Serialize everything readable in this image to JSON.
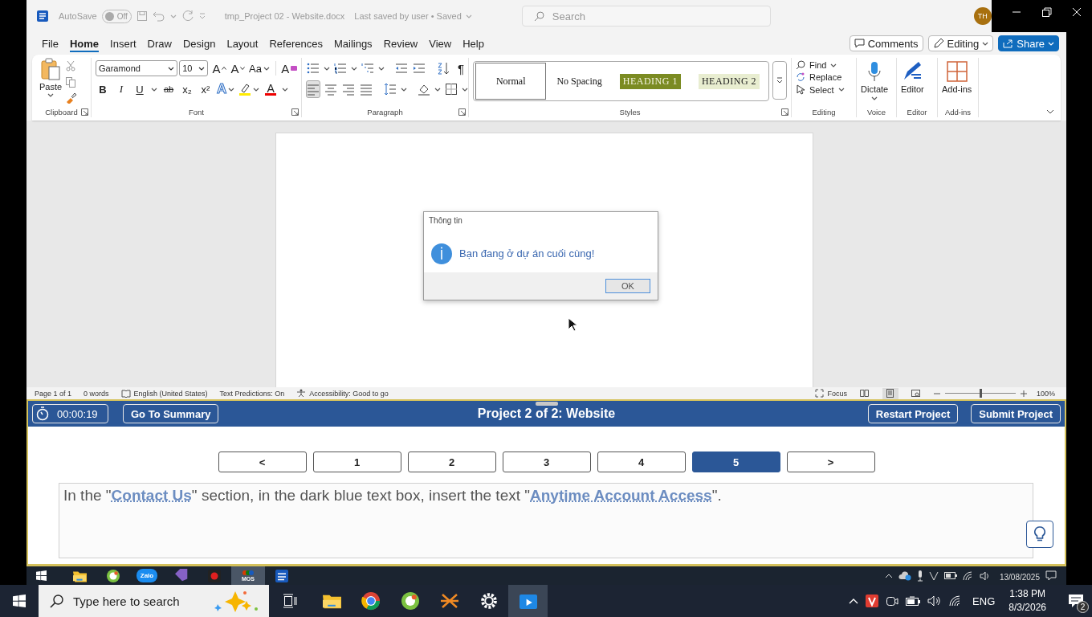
{
  "title_bar": {
    "autosave_label": "AutoSave",
    "autosave_toggle": {
      "label": "Off",
      "on": false
    },
    "document_title": "tmp_Project 02 - Website.docx",
    "save_status": "Last saved by user • Saved",
    "search": {
      "placeholder": "Search"
    },
    "avatar": "TH"
  },
  "ribbon_tabs": [
    {
      "label": "File",
      "selected": false
    },
    {
      "label": "Home",
      "selected": true
    },
    {
      "label": "Insert",
      "selected": false
    },
    {
      "label": "Draw",
      "selected": false
    },
    {
      "label": "Design",
      "selected": false
    },
    {
      "label": "Layout",
      "selected": false
    },
    {
      "label": "References",
      "selected": false
    },
    {
      "label": "Mailings",
      "selected": false
    },
    {
      "label": "Review",
      "selected": false
    },
    {
      "label": "View",
      "selected": false
    },
    {
      "label": "Help",
      "selected": false
    }
  ],
  "ribbon_actions": [
    {
      "kind": "comments",
      "label": "Comments"
    },
    {
      "kind": "editing",
      "label": "Editing"
    },
    {
      "kind": "share",
      "label": "Share"
    }
  ],
  "ribbon": {
    "clipboard": {
      "label": "Clipboard",
      "paste": "Paste"
    },
    "font": {
      "label": "Font",
      "font_name": "Garamond",
      "font_size": "10",
      "row1": [
        {
          "kind": "grow",
          "label": "A"
        },
        {
          "kind": "shrink",
          "label": "A"
        },
        {
          "kind": "case",
          "label": "Aa"
        },
        {
          "kind": "clear",
          "label": "A"
        }
      ],
      "row2": [
        {
          "kind": "bold",
          "label": "B"
        },
        {
          "kind": "italic",
          "label": "I"
        },
        {
          "kind": "underline",
          "label": "U"
        },
        {
          "kind": "strike",
          "label": "ab"
        },
        {
          "kind": "subscript",
          "label": "x₂"
        },
        {
          "kind": "superscript",
          "label": "x²"
        },
        {
          "kind": "effects",
          "label": "A"
        },
        {
          "kind": "highlight"
        },
        {
          "kind": "color",
          "label": "A"
        }
      ]
    },
    "paragraph": {
      "label": "Paragraph",
      "row1": [
        {
          "kind": "bullets"
        },
        {
          "kind": "numbering"
        },
        {
          "kind": "multilevel"
        },
        {
          "kind": "outdent"
        },
        {
          "kind": "indent"
        },
        {
          "kind": "sort"
        },
        {
          "kind": "marks",
          "label": "¶"
        }
      ],
      "row2": [
        {
          "kind": "align-left",
          "selected": true
        },
        {
          "kind": "align-center",
          "selected": false
        },
        {
          "kind": "align-right",
          "selected": false
        },
        {
          "kind": "justify",
          "selected": false
        },
        {
          "kind": "line-spacing"
        },
        {
          "kind": "shading"
        },
        {
          "kind": "borders"
        }
      ]
    },
    "styles": {
      "label": "Styles",
      "items": [
        {
          "kind": "normal",
          "label": "Normal",
          "selected": true
        },
        {
          "kind": "no-spacing",
          "label": "No Spacing",
          "selected": false
        },
        {
          "kind": "heading1",
          "label": "HEADING 1",
          "selected": false
        },
        {
          "kind": "heading2",
          "label": "HEADING 2",
          "selected": false
        }
      ]
    },
    "editing": {
      "label": "Editing",
      "items": [
        {
          "kind": "find",
          "label": "Find"
        },
        {
          "kind": "replace",
          "label": "Replace"
        },
        {
          "kind": "select",
          "label": "Select"
        }
      ]
    },
    "voice": {
      "label": "Voice",
      "button": "Dictate"
    },
    "editor": {
      "label": "Editor",
      "button": "Editor"
    },
    "addins": {
      "label": "Add-ins",
      "button": "Add-ins"
    }
  },
  "dialog": {
    "title": "Thông tin",
    "message": "Bạn đang ở dự án cuối cùng!",
    "button": "OK"
  },
  "status_bar": {
    "items": [
      "Page 1 of 1",
      "0 words",
      "English (United States)",
      "Text Predictions: On",
      "Accessibility: Good to go"
    ],
    "focus": "Focus",
    "views": [
      {
        "kind": "read",
        "selected": false
      },
      {
        "kind": "print",
        "selected": true
      },
      {
        "kind": "web",
        "selected": false
      }
    ],
    "zoom_slider": {
      "level": 0.5
    },
    "zoom": "100%"
  },
  "test_panel": {
    "timer": "00:00:19",
    "summary_button": "Go To Summary",
    "title": "Project 2 of 2: Website",
    "buttons": [
      "Restart Project",
      "Submit Project"
    ],
    "pages": [
      {
        "label": "<",
        "selected": false
      },
      {
        "label": "1",
        "selected": false
      },
      {
        "label": "2",
        "selected": false
      },
      {
        "label": "3",
        "selected": false
      },
      {
        "label": "4",
        "selected": false
      },
      {
        "label": "5",
        "selected": true
      },
      {
        "label": ">",
        "selected": false
      }
    ],
    "instruction": [
      {
        "kind": "text",
        "text": "In the \""
      },
      {
        "kind": "link",
        "text": "Contact Us"
      },
      {
        "kind": "text",
        "text": "\" section, in the dark blue text box, insert the text \""
      },
      {
        "kind": "link",
        "text": "Anytime Account Access"
      },
      {
        "kind": "text",
        "text": "\"."
      }
    ]
  },
  "inner_taskbar": {
    "apps": [
      {
        "kind": "folder",
        "selected": false
      },
      {
        "kind": "browser-green",
        "selected": false
      },
      {
        "kind": "chat",
        "label": "Zalo",
        "selected": false
      },
      {
        "kind": "ide",
        "selected": false
      },
      {
        "kind": "recorder",
        "selected": false
      },
      {
        "kind": "mos",
        "label": "MOS",
        "selected": true
      },
      {
        "kind": "word",
        "selected": false
      }
    ],
    "date": "13/08/2025"
  },
  "taskbar": {
    "search": {
      "placeholder": "Type here to search"
    },
    "apps": [
      {
        "kind": "folder",
        "selected": false
      },
      {
        "kind": "chrome",
        "selected": false
      },
      {
        "kind": "browser-green",
        "selected": false
      },
      {
        "kind": "xmind",
        "selected": false
      },
      {
        "kind": "settings",
        "selected": false
      },
      {
        "kind": "video",
        "selected": true
      }
    ],
    "language": "ENG",
    "time": "1:38 PM",
    "date": "8/3/2026",
    "notifications": "2"
  }
}
